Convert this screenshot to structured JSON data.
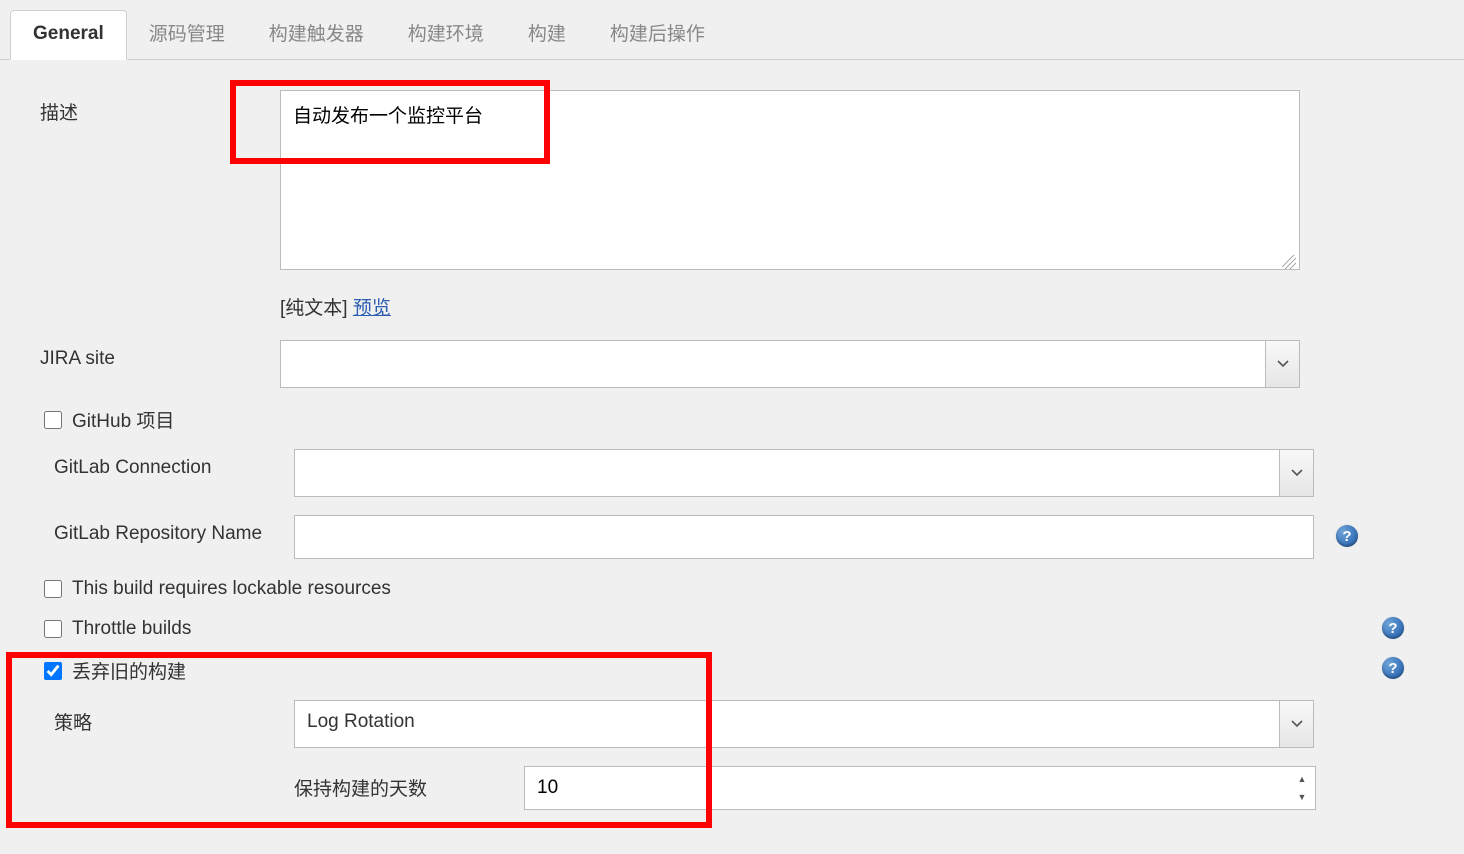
{
  "tabs": [
    {
      "label": "General",
      "active": true
    },
    {
      "label": "源码管理",
      "active": false
    },
    {
      "label": "构建触发器",
      "active": false
    },
    {
      "label": "构建环境",
      "active": false
    },
    {
      "label": "构建",
      "active": false
    },
    {
      "label": "构建后操作",
      "active": false
    }
  ],
  "description": {
    "label": "描述",
    "value": "自动发布一个监控平台",
    "hint_prefix": "[纯文本] ",
    "hint_link": "预览"
  },
  "jira": {
    "label": "JIRA site",
    "value": ""
  },
  "github_project": {
    "label": "GitHub 项目",
    "checked": false
  },
  "gitlab_connection": {
    "label": "GitLab Connection",
    "value": ""
  },
  "gitlab_repo": {
    "label": "GitLab Repository Name",
    "value": ""
  },
  "lockable": {
    "label": "This build requires lockable resources",
    "checked": false
  },
  "throttle": {
    "label": "Throttle builds",
    "checked": false
  },
  "discard_old": {
    "label": "丢弃旧的构建",
    "checked": true
  },
  "strategy": {
    "label": "策略",
    "value": "Log Rotation"
  },
  "days_to_keep": {
    "label": "保持构建的天数",
    "value": "10"
  },
  "help_glyph": "?"
}
